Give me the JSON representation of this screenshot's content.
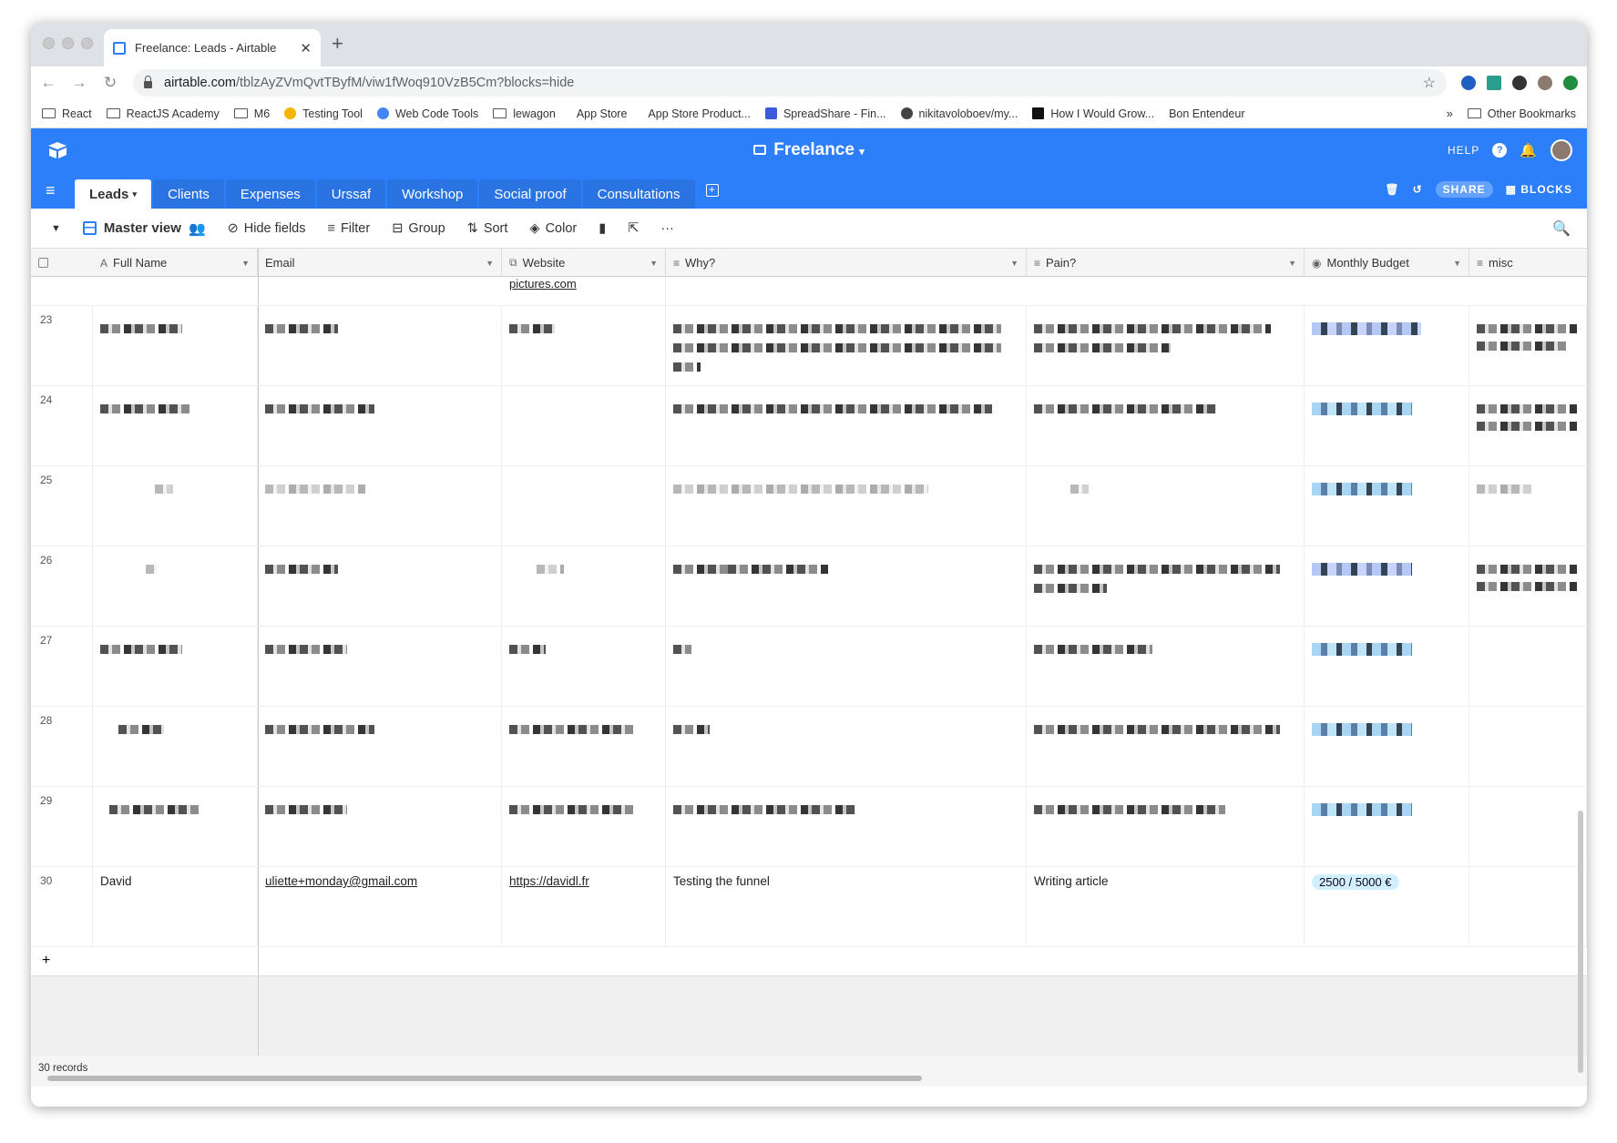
{
  "browser": {
    "tab_title": "Freelance: Leads - Airtable",
    "url_host": "airtable.com",
    "url_path": "/tblzAyZVmQvtTByfM/viw1fWoq910VzB5Cm?blocks=hide",
    "bookmarks": [
      "React",
      "ReactJS Academy",
      "M6",
      "Testing Tool",
      "Web Code Tools",
      "lewagon",
      "App Store",
      "App Store Product...",
      "SpreadShare - Fin...",
      "nikitavoloboev/my...",
      "How I Would Grow...",
      "Bon Entendeur"
    ],
    "overflow": "»",
    "other_bookmarks": "Other Bookmarks"
  },
  "header": {
    "base_name": "Freelance",
    "help": "HELP"
  },
  "tables": {
    "items": [
      "Leads",
      "Clients",
      "Expenses",
      "Urssaf",
      "Workshop",
      "Social proof",
      "Consultations"
    ],
    "share": "SHARE",
    "blocks": "BLOCKS"
  },
  "toolbar": {
    "view_name": "Master view",
    "hide_fields": "Hide fields",
    "filter": "Filter",
    "group": "Group",
    "sort": "Sort",
    "color": "Color",
    "more": "···"
  },
  "columns": [
    "Full Name",
    "Email",
    "Website",
    "Why?",
    "Pain?",
    "Monthly Budget",
    "misc"
  ],
  "rows": {
    "partial_website": "pictures.com",
    "numbers": [
      "23",
      "24",
      "25",
      "26",
      "27",
      "28",
      "29"
    ],
    "last": {
      "num": "30",
      "name": "David",
      "email": "uliette+monday@gmail.com",
      "website": "https://davidl.fr",
      "why": "Testing the funnel",
      "pain": "Writing article",
      "budget": "2500 / 5000 €"
    }
  },
  "footer": {
    "records": "30 records",
    "add": "+"
  },
  "colors": {
    "brand": "#2d7ff9",
    "pill": "#d0f0fd"
  }
}
